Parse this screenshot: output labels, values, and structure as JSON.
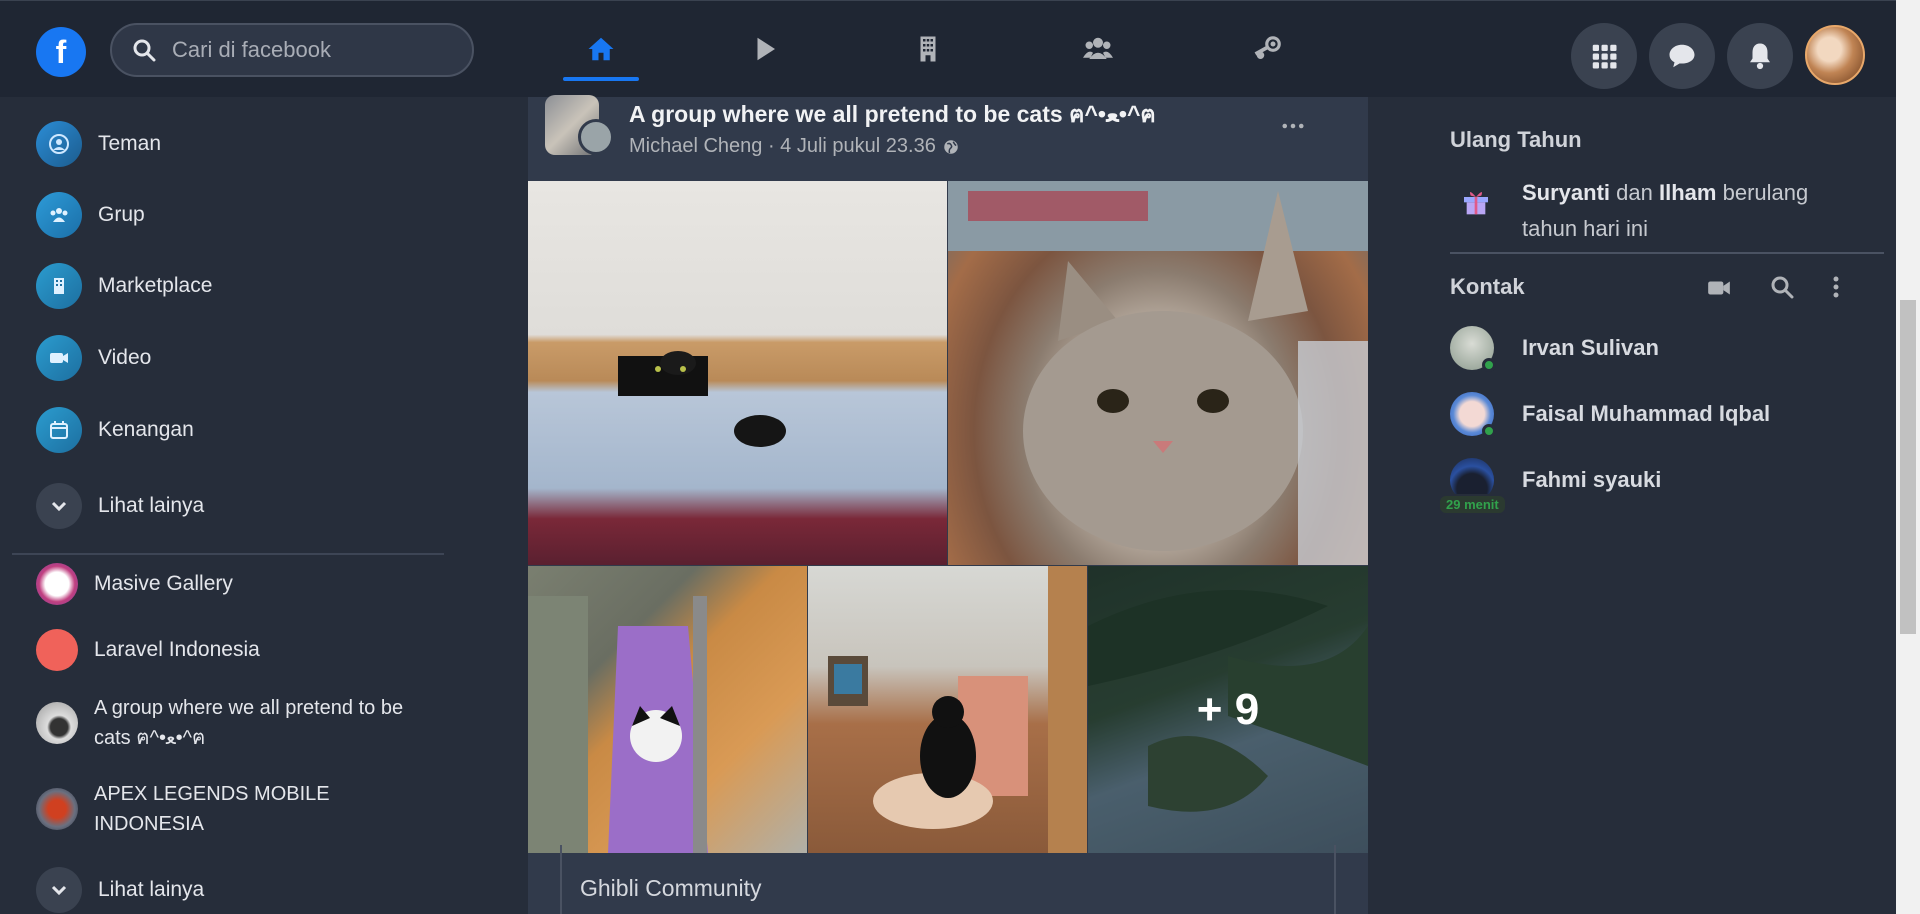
{
  "topbar": {
    "logo": "f",
    "search_placeholder": "Cari di facebook",
    "nav": [
      "home",
      "watch",
      "marketplace",
      "groups",
      "gaming"
    ],
    "actions": [
      "menu",
      "messenger",
      "notifications",
      "profile"
    ]
  },
  "sidebar": {
    "items": [
      {
        "label": "Teman",
        "icon": "friends-icon"
      },
      {
        "label": "Grup",
        "icon": "groups-icon"
      },
      {
        "label": "Marketplace",
        "icon": "marketplace-icon"
      },
      {
        "label": "Video",
        "icon": "video-icon"
      },
      {
        "label": "Kenangan",
        "icon": "memories-icon"
      }
    ],
    "see_more_1": "Lihat lainya",
    "groups": [
      {
        "label": "Masive Gallery"
      },
      {
        "label": "Laravel Indonesia"
      },
      {
        "label": "A group where we all pretend to be cats ฅ^•ﻌ•^ฅ"
      },
      {
        "label": "APEX LEGENDS MOBILE INDONESIA"
      }
    ],
    "see_more_2": "Lihat lainya"
  },
  "post": {
    "title": "A group where we all pretend to be cats ฅ^•ﻌ•^ฅ",
    "meta": "Michael Cheng · 4 Juli pukul 23.36",
    "more_photos": "+ 9",
    "shared_group": "Ghibli Community"
  },
  "right": {
    "birthday_heading": "Ulang Tahun",
    "birthday_name1": "Suryanti",
    "birthday_and": "dan",
    "birthday_name2": "Ilham",
    "birthday_suffix": "berulang tahun hari ini",
    "contacts_heading": "Kontak",
    "contacts": [
      {
        "name": "Irvan Sulivan",
        "online": true
      },
      {
        "name": "Faisal Muhammad Iqbal",
        "online": true
      },
      {
        "name": "Fahmi syauki",
        "badge": "29 menit"
      }
    ]
  },
  "colors": {
    "accent": "#1877f2",
    "online": "#31a24c",
    "background": "#262d3a",
    "card": "#313a4b"
  }
}
